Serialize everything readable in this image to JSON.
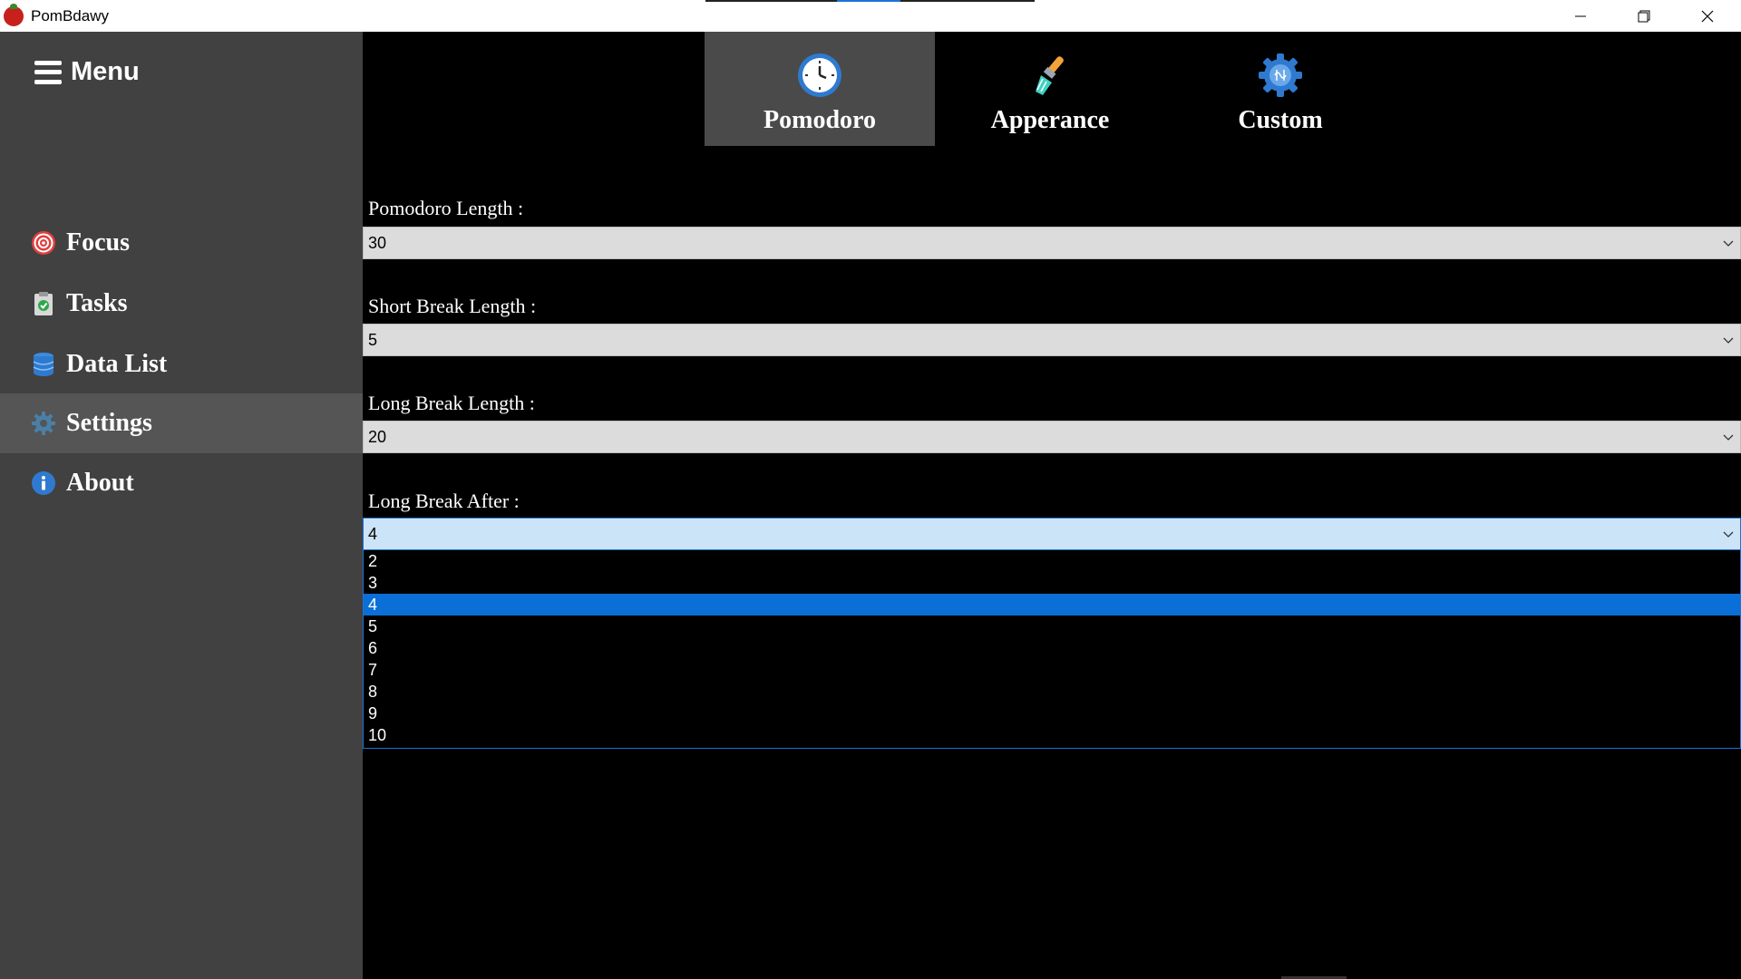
{
  "window": {
    "title": "PomBdawy"
  },
  "sidebar": {
    "menu_label": "Menu",
    "items": [
      {
        "label": "Focus",
        "icon": "target-icon",
        "active": false
      },
      {
        "label": "Tasks",
        "icon": "clipboard-check-icon",
        "active": false
      },
      {
        "label": "Data List",
        "icon": "database-icon",
        "active": false
      },
      {
        "label": "Settings",
        "icon": "gear-icon",
        "active": true
      },
      {
        "label": "About",
        "icon": "info-icon",
        "active": false
      }
    ]
  },
  "tabs": [
    {
      "label": "Pomodoro",
      "icon": "clock-icon",
      "active": true
    },
    {
      "label": "Apperance",
      "icon": "paintbrush-icon",
      "active": false
    },
    {
      "label": "Custom",
      "icon": "custom-gear-icon",
      "active": false
    }
  ],
  "form": {
    "pomodoro_length": {
      "label": "Pomodoro Length :",
      "value": "30"
    },
    "short_break_length": {
      "label": "Short Break Length :",
      "value": "5"
    },
    "long_break_length": {
      "label": "Long Break Length :",
      "value": "20"
    },
    "long_break_after": {
      "label": "Long Break After :",
      "value": "4",
      "open": true,
      "options": [
        "2",
        "3",
        "4",
        "5",
        "6",
        "7",
        "8",
        "9",
        "10"
      ],
      "selected_option": "4"
    }
  },
  "colors": {
    "sidebar_bg": "#414141",
    "active_item_bg": "#555555",
    "content_bg": "#000000",
    "selection_blue": "#0a6fd6"
  }
}
